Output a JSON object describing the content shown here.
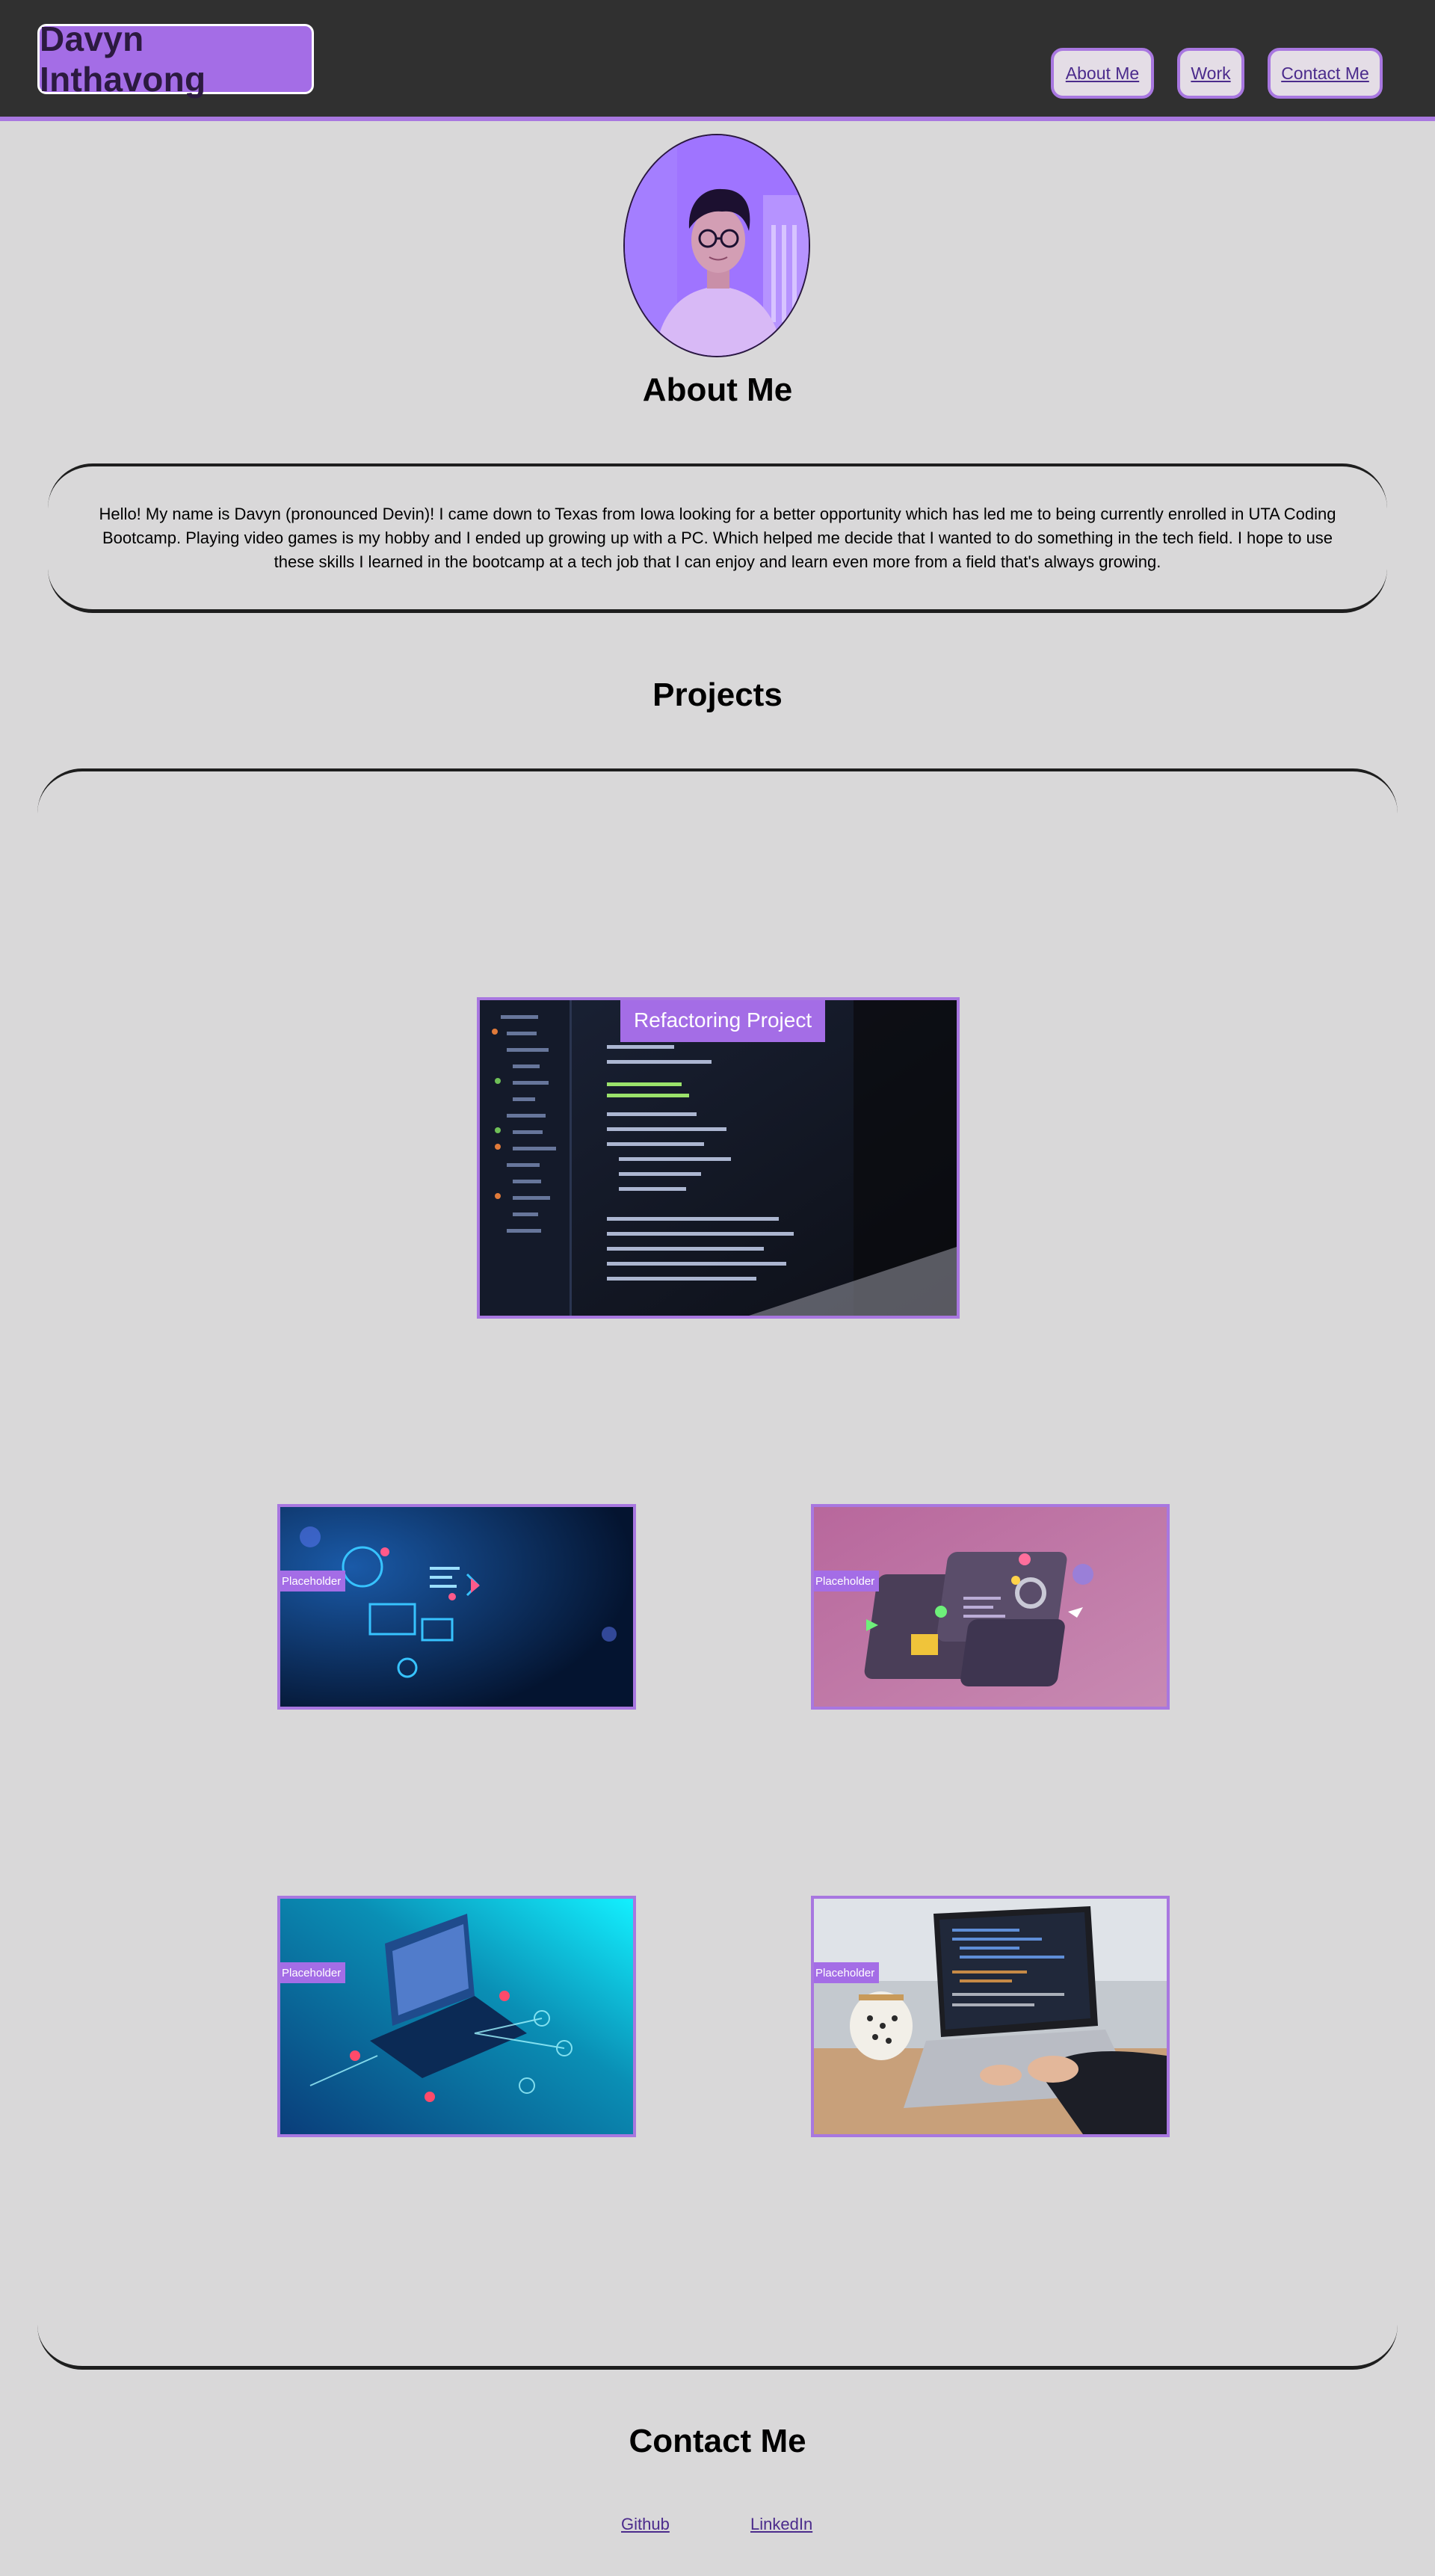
{
  "header": {
    "logo_text": "Davyn Inthavong",
    "nav": [
      {
        "label": "About Me"
      },
      {
        "label": "Work"
      },
      {
        "label": "Contact Me"
      }
    ]
  },
  "about": {
    "title": "About Me",
    "text": "Hello! My name is Davyn (pronounced Devin)! I came down to Texas from Iowa looking for a better opportunity which has led me to being currently enrolled in UTA Coding Bootcamp. Playing video games is my hobby and I ended up growing up with a PC. Which helped me decide that I wanted to do something in the tech field. I hope to use these skills I learned in the bootcamp at a tech job that I can enjoy and learn even more from a field that's always growing."
  },
  "projects": {
    "title": "Projects",
    "featured_label": "Refactoring Project",
    "items": [
      {
        "label": "Placeholder"
      },
      {
        "label": "Placeholder"
      },
      {
        "label": "Placeholder"
      },
      {
        "label": "Placeholder"
      }
    ]
  },
  "contact": {
    "title": "Contact Me",
    "links": [
      {
        "label": "Github"
      },
      {
        "label": "LinkedIn"
      }
    ]
  },
  "colors": {
    "accent": "#a877e0",
    "logo_bg": "#a46de6",
    "header_bg": "#303030",
    "page_bg": "#d9d8d9",
    "link": "#4b2b8c"
  }
}
